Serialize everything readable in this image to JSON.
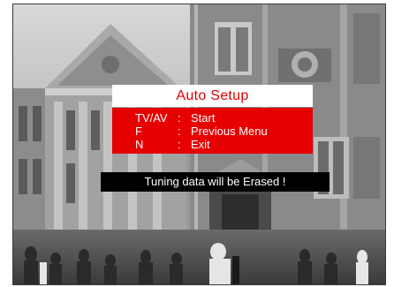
{
  "osd": {
    "title": "Auto Setup",
    "menu": [
      {
        "key": "TV/AV",
        "separator": ":",
        "action": "Start"
      },
      {
        "key": "F",
        "separator": ":",
        "action": "Previous Menu"
      },
      {
        "key": "N",
        "separator": ":",
        "action": "Exit"
      }
    ],
    "warning": "Tuning data will be Erased !"
  },
  "colors": {
    "title_text": "#e00000",
    "menu_background": "#e60000",
    "warning_background": "#000000"
  },
  "background_image": "grayscale photo of historic stone building facade with pedestrians"
}
